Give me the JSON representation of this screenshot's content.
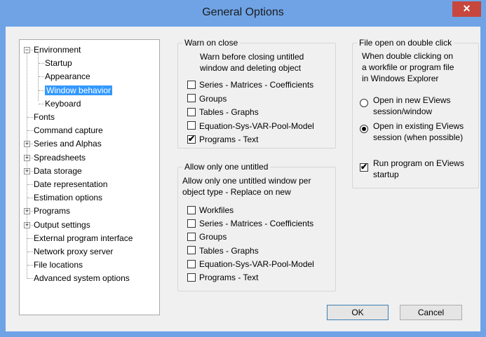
{
  "window": {
    "title": "General Options",
    "close_glyph": "✕"
  },
  "tree": {
    "items": [
      {
        "label": "Environment",
        "level": 0,
        "expander": "−"
      },
      {
        "label": "Startup",
        "level": 1
      },
      {
        "label": "Appearance",
        "level": 1
      },
      {
        "label": "Window behavior",
        "level": 1,
        "selected": true
      },
      {
        "label": "Keyboard",
        "level": 1
      },
      {
        "label": "Fonts",
        "level": 0
      },
      {
        "label": "Command capture",
        "level": 0
      },
      {
        "label": "Series and Alphas",
        "level": 0,
        "expander": "+"
      },
      {
        "label": "Spreadsheets",
        "level": 0,
        "expander": "+"
      },
      {
        "label": "Data storage",
        "level": 0,
        "expander": "+"
      },
      {
        "label": "Date representation",
        "level": 0
      },
      {
        "label": "Estimation options",
        "level": 0
      },
      {
        "label": "Programs",
        "level": 0,
        "expander": "+"
      },
      {
        "label": "Output settings",
        "level": 0,
        "expander": "+"
      },
      {
        "label": "External program interface",
        "level": 0
      },
      {
        "label": "Network proxy server",
        "level": 0
      },
      {
        "label": "File locations",
        "level": 0
      },
      {
        "label": "Advanced system options",
        "level": 0
      }
    ]
  },
  "warn_on_close": {
    "legend": "Warn on close",
    "desc1": "Warn before closing untitled",
    "desc2": "window and deleting object",
    "options": [
      {
        "label": "Series - Matrices - Coefficients",
        "checked": false
      },
      {
        "label": "Groups",
        "checked": false
      },
      {
        "label": "Tables - Graphs",
        "checked": false
      },
      {
        "label": "Equation-Sys-VAR-Pool-Model",
        "checked": false
      },
      {
        "label": "Programs - Text",
        "checked": true
      }
    ]
  },
  "allow_one": {
    "legend": "Allow only one untitled",
    "desc1": "Allow only one untitled window per",
    "desc2": "object type - Replace on new",
    "options": [
      {
        "label": "Workfiles",
        "checked": false
      },
      {
        "label": "Series - Matrices - Coefficients",
        "checked": false
      },
      {
        "label": "Groups",
        "checked": false
      },
      {
        "label": "Tables - Graphs",
        "checked": false
      },
      {
        "label": "Equation-Sys-VAR-Pool-Model",
        "checked": false
      },
      {
        "label": "Programs - Text",
        "checked": false
      }
    ]
  },
  "file_open": {
    "legend": "File open on double click",
    "desc1": "When double clicking on",
    "desc2": "a workfile or program file",
    "desc3": "in Windows Explorer",
    "radio1_line1": "Open in new EViews",
    "radio1_line2": "session/window",
    "radio2_line1": "Open in existing EViews",
    "radio2_line2": "session (when possible)",
    "selected_radio": 2,
    "run_line1": "Run program on EViews",
    "run_line2": "startup",
    "run_checked": true
  },
  "buttons": {
    "ok": "OK",
    "cancel": "Cancel"
  },
  "check_glyph": "✔"
}
